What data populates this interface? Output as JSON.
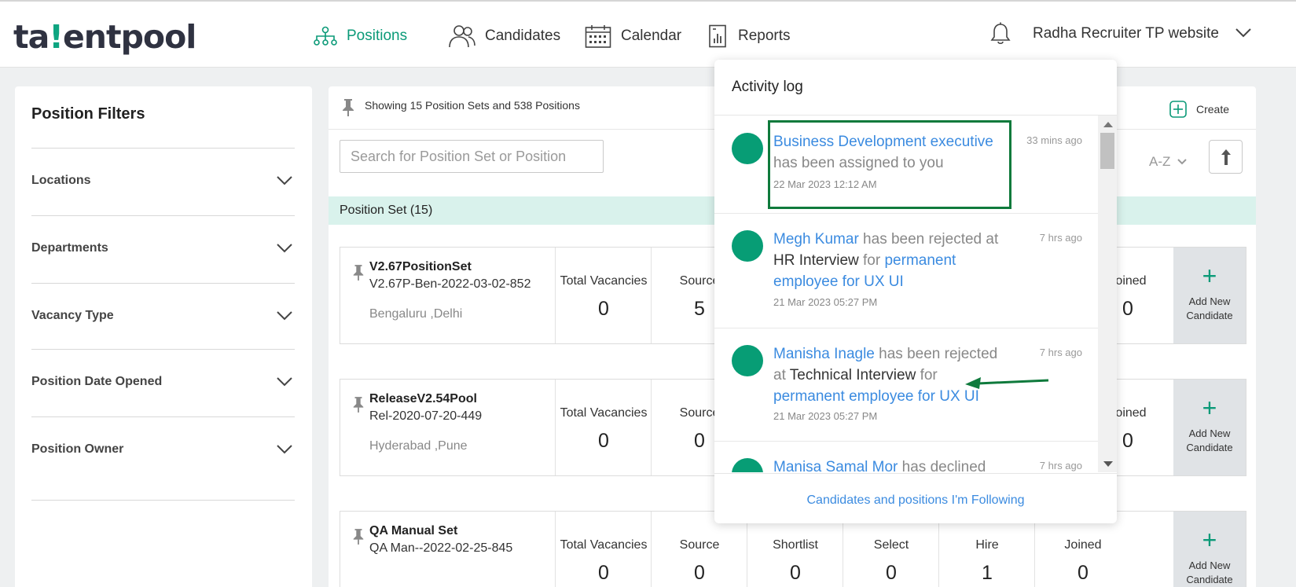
{
  "brand": {
    "logo_pre": "ta",
    "logo_accent": "!",
    "logo_post": "entpool"
  },
  "nav": [
    {
      "label": "Positions",
      "icon": "hierarchy-icon"
    },
    {
      "label": "Candidates",
      "icon": "people-icon"
    },
    {
      "label": "Calendar",
      "icon": "calendar-icon"
    },
    {
      "label": "Reports",
      "icon": "report-icon"
    }
  ],
  "user": {
    "name": "Radha Recruiter TP website"
  },
  "sidebar": {
    "title": "Position Filters",
    "filters": [
      "Locations",
      "Departments",
      "Vacancy Type",
      "Position Date Opened",
      "Position Owner"
    ]
  },
  "main": {
    "showing": "Showing 15 Position Sets and 538 Positions",
    "create_label": "Create",
    "search_placeholder": "Search for Position Set or Position",
    "sort_label": "A-Z",
    "set_heading": "Position Set (15)",
    "stat_labels": [
      "Total Vacancies",
      "Source",
      "Shortlist",
      "Select",
      "Hire",
      "Joined"
    ],
    "add_new_line1": "Add New",
    "add_new_line2": "Candidate",
    "cards": [
      {
        "name": "V2.67PositionSet",
        "code": "V2.67P-Ben-2022-03-02-852",
        "location": "Bengaluru ,Delhi",
        "stats": [
          "0",
          "5",
          "",
          "",
          "",
          "0"
        ]
      },
      {
        "name": "ReleaseV2.54Pool",
        "code": "Rel-2020-07-20-449",
        "location": "Hyderabad ,Pune",
        "stats": [
          "0",
          "0",
          "",
          "",
          "",
          "0"
        ]
      },
      {
        "name": "QA Manual Set",
        "code": "QA Man--2022-02-25-845",
        "location": "",
        "stats": [
          "0",
          "0",
          "0",
          "0",
          "1",
          "0"
        ]
      }
    ]
  },
  "activity": {
    "title": "Activity log",
    "items": [
      {
        "part1": "Business Development executive",
        "part2": " has been assigned to you",
        "date": "22 Mar 2023 12:12 AM",
        "ago": "33 mins ago"
      },
      {
        "part1": "Megh Kumar",
        "part2": " has been rejected at ",
        "part3": "HR Interview",
        "part4": " for ",
        "part5": "permanent employee for UX UI",
        "date": "21 Mar 2023 05:27 PM",
        "ago": "7 hrs ago"
      },
      {
        "part1": "Manisha Inagle",
        "part2": " has been rejected at ",
        "part3": "Technical Interview",
        "part4": " for ",
        "part5": "permanent employee for UX UI",
        "date": "21 Mar 2023 05:27 PM",
        "ago": "7 hrs ago"
      },
      {
        "part1": "Manisa Samal Mor",
        "part2": " has declined",
        "ago": "7 hrs ago"
      }
    ],
    "footer": "Candidates and positions I'm Following"
  },
  "colors": {
    "brand": "#0ea581",
    "link": "#3b8be0",
    "dot": "#079d75",
    "highlight": "#0f7a3c",
    "set_bar": "#d9f2ec"
  }
}
